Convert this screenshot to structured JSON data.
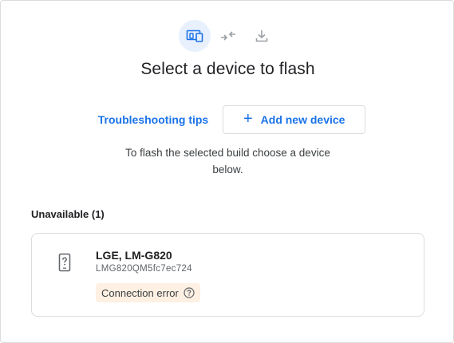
{
  "stepper": {
    "steps": [
      {
        "icon": "devices-icon",
        "state": "active"
      },
      {
        "icon": "connect-arrows-icon",
        "state": "inactive"
      },
      {
        "icon": "download-icon",
        "state": "inactive"
      }
    ],
    "active_color": "#1a73e8",
    "inactive_color": "#9aa0a6"
  },
  "header": {
    "title": "Select a device to flash"
  },
  "actions": {
    "troubleshooting_label": "Troubleshooting tips",
    "add_device_icon": "+",
    "add_device_label": "Add new device"
  },
  "hint": "To flash the selected build choose a device below.",
  "unavailable": {
    "label": "Unavailable (1)",
    "devices": [
      {
        "icon": "phone-unknown-icon",
        "name": "LGE, LM-G820",
        "serial": "LMG820QM5fc7ec724",
        "status": "Connection error",
        "status_icon": "help-icon",
        "status_color": "#fef0e2"
      }
    ]
  }
}
